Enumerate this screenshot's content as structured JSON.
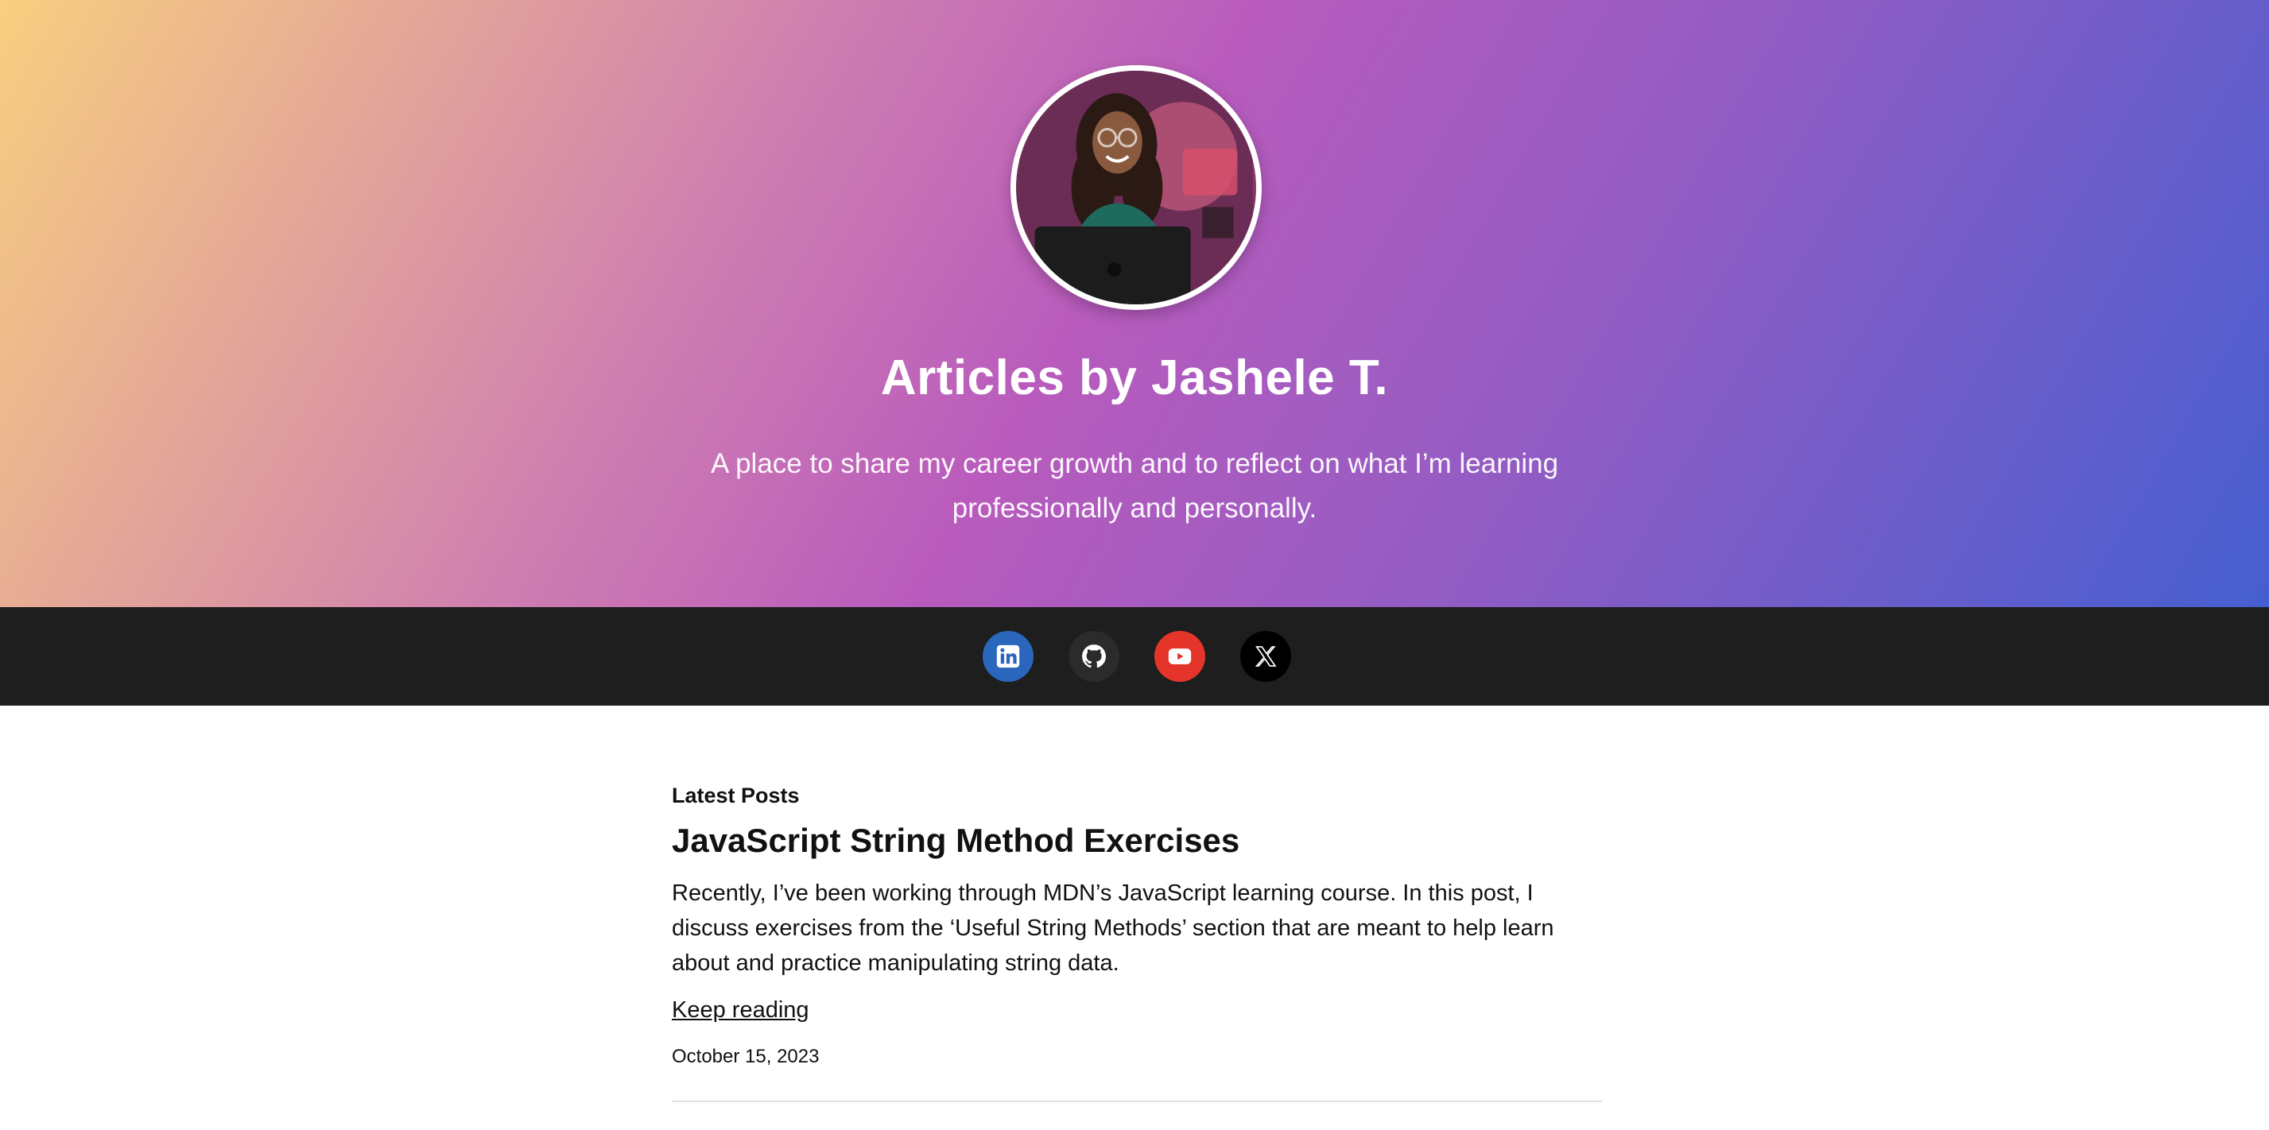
{
  "hero": {
    "title": "Articles by Jashele T.",
    "subtitle": "A place to share my career growth and to reflect on what I’m learning professionally and personally.",
    "gradient_colors": [
      "#f8cf7f",
      "#cf7fb0",
      "#b95bbd",
      "#8e5cc4",
      "#455fd0"
    ]
  },
  "social": {
    "bar_color": "#1e1e1e",
    "items": [
      {
        "name": "linkedin",
        "icon": "linkedin-icon",
        "color": "#2a66bc"
      },
      {
        "name": "github",
        "icon": "github-icon",
        "color": "#2b2b2b"
      },
      {
        "name": "youtube",
        "icon": "youtube-icon",
        "color": "#e5352b"
      },
      {
        "name": "x",
        "icon": "x-icon",
        "color": "#000000"
      }
    ]
  },
  "main": {
    "section_label": "Latest Posts",
    "posts": [
      {
        "title": "JavaScript String Method Exercises",
        "excerpt": "Recently, I’ve been working through MDN’s JavaScript learning course. In this post, I discuss exercises from the ‘Useful String Methods’ section that are meant to help learn about and practice manipulating string data.",
        "link_label": "Keep reading",
        "date": "October 15, 2023"
      }
    ]
  }
}
